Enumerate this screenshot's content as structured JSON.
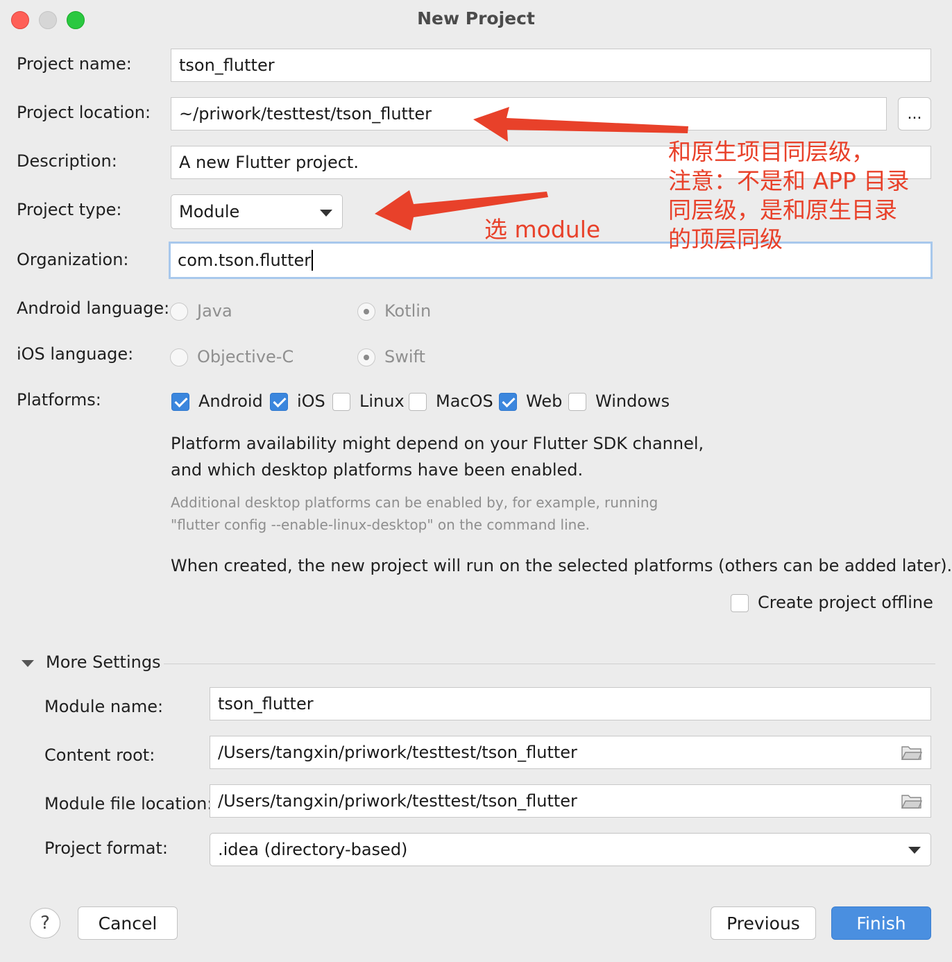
{
  "window": {
    "title": "New Project"
  },
  "form": {
    "project_name_label": "Project name:",
    "project_name_value": "tson_flutter",
    "project_location_label": "Project location:",
    "project_location_value": "~/priwork/testtest/tson_flutter",
    "browse_label": "...",
    "description_label": "Description:",
    "description_value": "A new Flutter project.",
    "project_type_label": "Project type:",
    "project_type_value": "Module",
    "organization_label": "Organization:",
    "organization_value": "com.tson.flutter",
    "android_language_label": "Android language:",
    "android_options": [
      "Java",
      "Kotlin"
    ],
    "android_selected": "Kotlin",
    "ios_language_label": "iOS language:",
    "ios_options": [
      "Objective-C",
      "Swift"
    ],
    "ios_selected": "Swift",
    "platforms_label": "Platforms:",
    "platforms": [
      {
        "label": "Android",
        "checked": true
      },
      {
        "label": "iOS",
        "checked": true
      },
      {
        "label": "Linux",
        "checked": false
      },
      {
        "label": "MacOS",
        "checked": false
      },
      {
        "label": "Web",
        "checked": true
      },
      {
        "label": "Windows",
        "checked": false
      }
    ],
    "platform_note_line1": "Platform availability might depend on your Flutter SDK channel,",
    "platform_note_line2": "and which desktop platforms have been enabled.",
    "desktop_note_line1": "Additional desktop platforms can be enabled by, for example, running",
    "desktop_note_line2": "\"flutter config --enable-linux-desktop\" on the command line.",
    "created_note": "When created, the new project will run on the selected platforms (others can be added later).",
    "offline_label": "Create project offline",
    "offline_checked": false
  },
  "more_settings": {
    "header": "More Settings",
    "module_name_label": "Module name:",
    "module_name_value": "tson_flutter",
    "content_root_label": "Content root:",
    "content_root_value": "/Users/tangxin/priwork/testtest/tson_flutter",
    "module_file_label": "Module file location:",
    "module_file_value": "/Users/tangxin/priwork/testtest/tson_flutter",
    "project_format_label": "Project format:",
    "project_format_value": ".idea (directory-based)"
  },
  "footer": {
    "help_label": "?",
    "cancel_label": "Cancel",
    "previous_label": "Previous",
    "finish_label": "Finish"
  },
  "annotations": {
    "location_note": [
      "和原生项目同层级，",
      "注意：不是和 APP 目录",
      "同层级，是和原生目录",
      "的顶层同级"
    ],
    "type_note": "选 module",
    "color": "#e8412a"
  },
  "colors": {
    "accent": "#4a8fe0",
    "annotation": "#e8412a"
  }
}
